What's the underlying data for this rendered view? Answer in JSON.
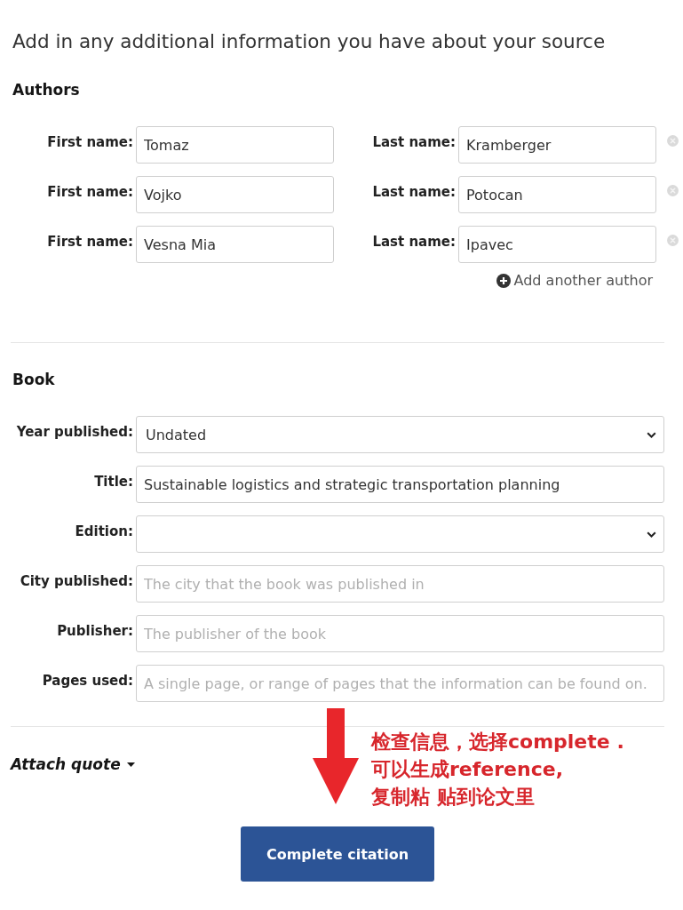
{
  "heading": "Add in any additional information you have about your source",
  "authors": {
    "title": "Authors",
    "rows": [
      {
        "first_label": "First name:",
        "first_name": "Tomaz",
        "last_label": "Last name:",
        "last_name": "Kramberger"
      },
      {
        "first_label": "First name:",
        "first_name": "Vojko",
        "last_label": "Last name:",
        "last_name": "Potocan"
      },
      {
        "first_label": "First name:",
        "first_name": "Vesna Mia",
        "last_label": "Last name:",
        "last_name": "Ipavec"
      }
    ],
    "add_link": "Add another author"
  },
  "book": {
    "title": "Book",
    "fields": [
      {
        "kind": "select",
        "label": "Year published:",
        "value": "Undated"
      },
      {
        "kind": "text",
        "label": "Title:",
        "value": "Sustainable logistics and strategic transportation planning"
      },
      {
        "kind": "select",
        "label": "Edition:"
      },
      {
        "kind": "text",
        "label": "City published:",
        "placeholder": "The city that the book was published in"
      },
      {
        "kind": "text",
        "label": "Publisher:",
        "placeholder": "The publisher of the book"
      },
      {
        "kind": "text",
        "label": "Pages used:",
        "placeholder": "A single page, or range of pages that the information can be found on."
      }
    ]
  },
  "attach_quote": "Attach quote",
  "submit": "Complete citation",
  "annotation": {
    "lines": [
      "检查信息，选择complete .",
      "可以生成reference,",
      "复制粘 贴到论文里"
    ]
  }
}
